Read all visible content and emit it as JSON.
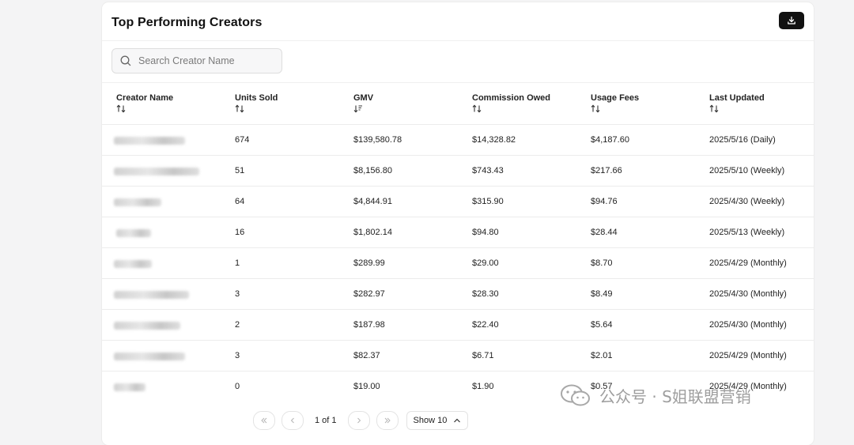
{
  "panel": {
    "title": "Top Performing Creators",
    "download_icon": "download-icon"
  },
  "search": {
    "placeholder": "Search Creator Name",
    "value": ""
  },
  "table": {
    "columns": [
      {
        "label": "Creator Name",
        "sort": "unsorted"
      },
      {
        "label": "Units Sold",
        "sort": "unsorted"
      },
      {
        "label": "GMV",
        "sort": "descending"
      },
      {
        "label": "Commission Owed",
        "sort": "unsorted"
      },
      {
        "label": "Usage Fees",
        "sort": "unsorted"
      },
      {
        "label": "Last Updated",
        "sort": "unsorted"
      }
    ],
    "rows": [
      {
        "units": "674",
        "gmv": "$139,580.78",
        "commission": "$14,328.82",
        "usage": "$4,187.60",
        "updated": "2025/5/16 (Daily)"
      },
      {
        "units": "51",
        "gmv": "$8,156.80",
        "commission": "$743.43",
        "usage": "$217.66",
        "updated": "2025/5/10 (Weekly)"
      },
      {
        "units": "64",
        "gmv": "$4,844.91",
        "commission": "$315.90",
        "usage": "$94.76",
        "updated": "2025/4/30 (Weekly)"
      },
      {
        "units": "16",
        "gmv": "$1,802.14",
        "commission": "$94.80",
        "usage": "$28.44",
        "updated": "2025/5/13 (Weekly)"
      },
      {
        "units": "1",
        "gmv": "$289.99",
        "commission": "$29.00",
        "usage": "$8.70",
        "updated": "2025/4/29 (Monthly)"
      },
      {
        "units": "3",
        "gmv": "$282.97",
        "commission": "$28.30",
        "usage": "$8.49",
        "updated": "2025/4/30 (Monthly)"
      },
      {
        "units": "2",
        "gmv": "$187.98",
        "commission": "$22.40",
        "usage": "$5.64",
        "updated": "2025/4/30 (Monthly)"
      },
      {
        "units": "3",
        "gmv": "$82.37",
        "commission": "$6.71",
        "usage": "$2.01",
        "updated": "2025/4/29 (Monthly)"
      },
      {
        "units": "0",
        "gmv": "$19.00",
        "commission": "$1.90",
        "usage": "$0.57",
        "updated": "2025/4/29 (Monthly)"
      }
    ]
  },
  "pagination": {
    "page_text": "1 of 1",
    "show_label": "Show 10"
  },
  "watermark": {
    "text": "公众号 · S姐联盟营销"
  }
}
